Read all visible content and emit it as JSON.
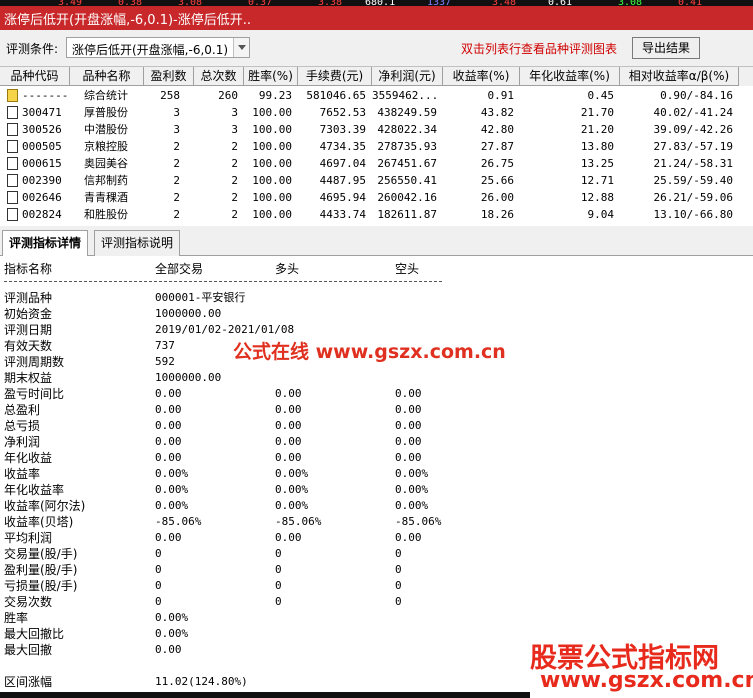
{
  "window": {
    "title": "涨停后低开(开盘涨幅,-6,0.1)-涨停后低开..",
    "strip_numbers": [
      "3.49",
      "0.38",
      "3.08",
      "0.37",
      "3.38",
      "680.1",
      "1337",
      "3.48",
      "0.61",
      "3.08",
      "0.41"
    ]
  },
  "toolbar": {
    "condition_label": "评测条件:",
    "condition_value": "涨停后低开(开盘涨幅,-6,0.1)",
    "hint": "双击列表行查看品种评测图表",
    "export_label": "导出结果"
  },
  "table": {
    "columns": [
      "品种代码",
      "品种名称",
      "盈利数",
      "总次数",
      "胜率(%)",
      "手续费(元)",
      "净利润(元)",
      "收益率(%)",
      "年化收益率(%)",
      "相对收益率α/β(%)"
    ],
    "rows": [
      {
        "code": "-------",
        "name": "综合统计",
        "wins": "258",
        "total": "260",
        "winrate": "99.23",
        "fee": "581046.65",
        "profit": "3559462...",
        "yield": "0.91",
        "annual": "0.45",
        "relative": "0.90/-84.16",
        "icon": "folder"
      },
      {
        "code": "300471",
        "name": "厚普股份",
        "wins": "3",
        "total": "3",
        "winrate": "100.00",
        "fee": "7652.53",
        "profit": "438249.59",
        "yield": "43.82",
        "annual": "21.70",
        "relative": "40.02/-41.24",
        "icon": "doc"
      },
      {
        "code": "300526",
        "name": "中潜股份",
        "wins": "3",
        "total": "3",
        "winrate": "100.00",
        "fee": "7303.39",
        "profit": "428022.34",
        "yield": "42.80",
        "annual": "21.20",
        "relative": "39.09/-42.26",
        "icon": "doc"
      },
      {
        "code": "000505",
        "name": "京粮控股",
        "wins": "2",
        "total": "2",
        "winrate": "100.00",
        "fee": "4734.35",
        "profit": "278735.93",
        "yield": "27.87",
        "annual": "13.80",
        "relative": "27.83/-57.19",
        "icon": "doc"
      },
      {
        "code": "000615",
        "name": "奥园美谷",
        "wins": "2",
        "total": "2",
        "winrate": "100.00",
        "fee": "4697.04",
        "profit": "267451.67",
        "yield": "26.75",
        "annual": "13.25",
        "relative": "21.24/-58.31",
        "icon": "doc"
      },
      {
        "code": "002390",
        "name": "信邦制药",
        "wins": "2",
        "total": "2",
        "winrate": "100.00",
        "fee": "4487.95",
        "profit": "256550.41",
        "yield": "25.66",
        "annual": "12.71",
        "relative": "25.59/-59.40",
        "icon": "doc"
      },
      {
        "code": "002646",
        "name": "青青稞酒",
        "wins": "2",
        "total": "2",
        "winrate": "100.00",
        "fee": "4695.94",
        "profit": "260042.16",
        "yield": "26.00",
        "annual": "12.88",
        "relative": "26.21/-59.06",
        "icon": "doc"
      },
      {
        "code": "002824",
        "name": "和胜股份",
        "wins": "2",
        "total": "2",
        "winrate": "100.00",
        "fee": "4433.74",
        "profit": "182611.87",
        "yield": "18.26",
        "annual": "9.04",
        "relative": "13.10/-66.80",
        "icon": "doc"
      }
    ]
  },
  "tabs": [
    {
      "label": "评测指标详情",
      "active": true
    },
    {
      "label": "评测指标说明",
      "active": false
    }
  ],
  "detail": {
    "headers": [
      "指标名称",
      "全部交易",
      "多头",
      "空头"
    ],
    "rows": [
      {
        "label": "评测品种",
        "all": "000001-平安银行",
        "long": "",
        "short": ""
      },
      {
        "label": "初始资金",
        "all": "1000000.00",
        "long": "",
        "short": ""
      },
      {
        "label": "评测日期",
        "all": "2019/01/02-2021/01/08",
        "long": "",
        "short": ""
      },
      {
        "label": "有效天数",
        "all": "737",
        "long": "",
        "short": ""
      },
      {
        "label": "评测周期数",
        "all": "592",
        "long": "",
        "short": ""
      },
      {
        "label": "期末权益",
        "all": "1000000.00",
        "long": "",
        "short": ""
      },
      {
        "label": "盈亏时间比",
        "all": "0.00",
        "long": "0.00",
        "short": "0.00"
      },
      {
        "label": "总盈利",
        "all": "0.00",
        "long": "0.00",
        "short": "0.00"
      },
      {
        "label": "总亏损",
        "all": "0.00",
        "long": "0.00",
        "short": "0.00"
      },
      {
        "label": "净利润",
        "all": "0.00",
        "long": "0.00",
        "short": "0.00"
      },
      {
        "label": "年化收益",
        "all": "0.00",
        "long": "0.00",
        "short": "0.00"
      },
      {
        "label": "收益率",
        "all": "0.00%",
        "long": "0.00%",
        "short": "0.00%"
      },
      {
        "label": "年化收益率",
        "all": "0.00%",
        "long": "0.00%",
        "short": "0.00%"
      },
      {
        "label": "收益率(阿尔法)",
        "all": "0.00%",
        "long": "0.00%",
        "short": "0.00%"
      },
      {
        "label": "收益率(贝塔)",
        "all": "-85.06%",
        "long": "-85.06%",
        "short": "-85.06%"
      },
      {
        "label": "平均利润",
        "all": "0.00",
        "long": "0.00",
        "short": "0.00"
      },
      {
        "label": "交易量(股/手)",
        "all": "0",
        "long": "0",
        "short": "0"
      },
      {
        "label": "盈利量(股/手)",
        "all": "0",
        "long": "0",
        "short": "0"
      },
      {
        "label": "亏损量(股/手)",
        "all": "0",
        "long": "0",
        "short": "0"
      },
      {
        "label": "交易次数",
        "all": "0",
        "long": "0",
        "short": "0"
      },
      {
        "label": "胜率",
        "all": "0.00%",
        "long": "",
        "short": ""
      },
      {
        "label": "最大回撤比",
        "all": "0.00%",
        "long": "",
        "short": ""
      },
      {
        "label": "最大回撤",
        "all": "0.00",
        "long": "",
        "short": ""
      },
      {
        "label": "",
        "all": "",
        "long": "",
        "short": ""
      },
      {
        "label": "区间涨幅",
        "all": "11.02(124.80%)",
        "long": "",
        "short": ""
      }
    ]
  },
  "watermarks": {
    "middle": "公式在线 www.gszx.com.cn",
    "corner_title": "股票公式指标网",
    "corner_url": "www.gszx.com.cn"
  },
  "colors": {
    "title_bar": "#c8282a",
    "hint_text": "#d00000",
    "watermark": "#e82a1c"
  }
}
